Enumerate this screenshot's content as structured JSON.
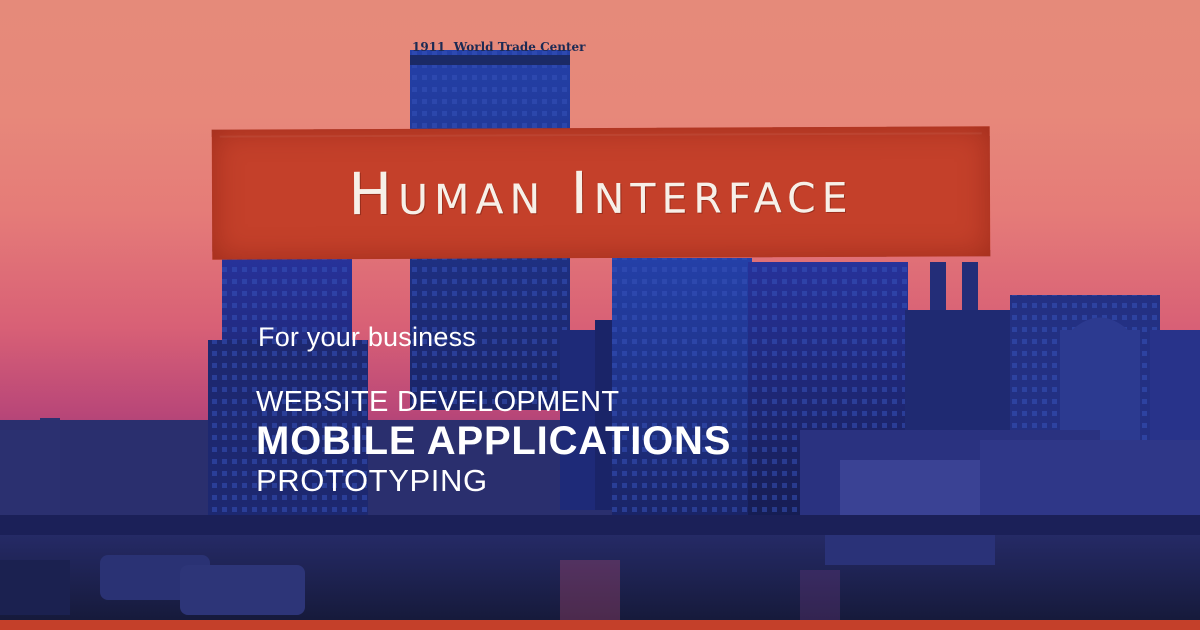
{
  "banner": {
    "title": "Human Interface"
  },
  "tagline": "For your business",
  "services": [
    "Website Development",
    "Mobile Applications",
    "Prototyping"
  ],
  "background": {
    "tower_sign": "World Trade Center",
    "logo_text": "1911"
  },
  "colors": {
    "banner": "#c4402a",
    "text": "#ffffff",
    "sky_top": "#e58a7a",
    "sky_mid": "#d86076",
    "city": "#1d2a78"
  }
}
